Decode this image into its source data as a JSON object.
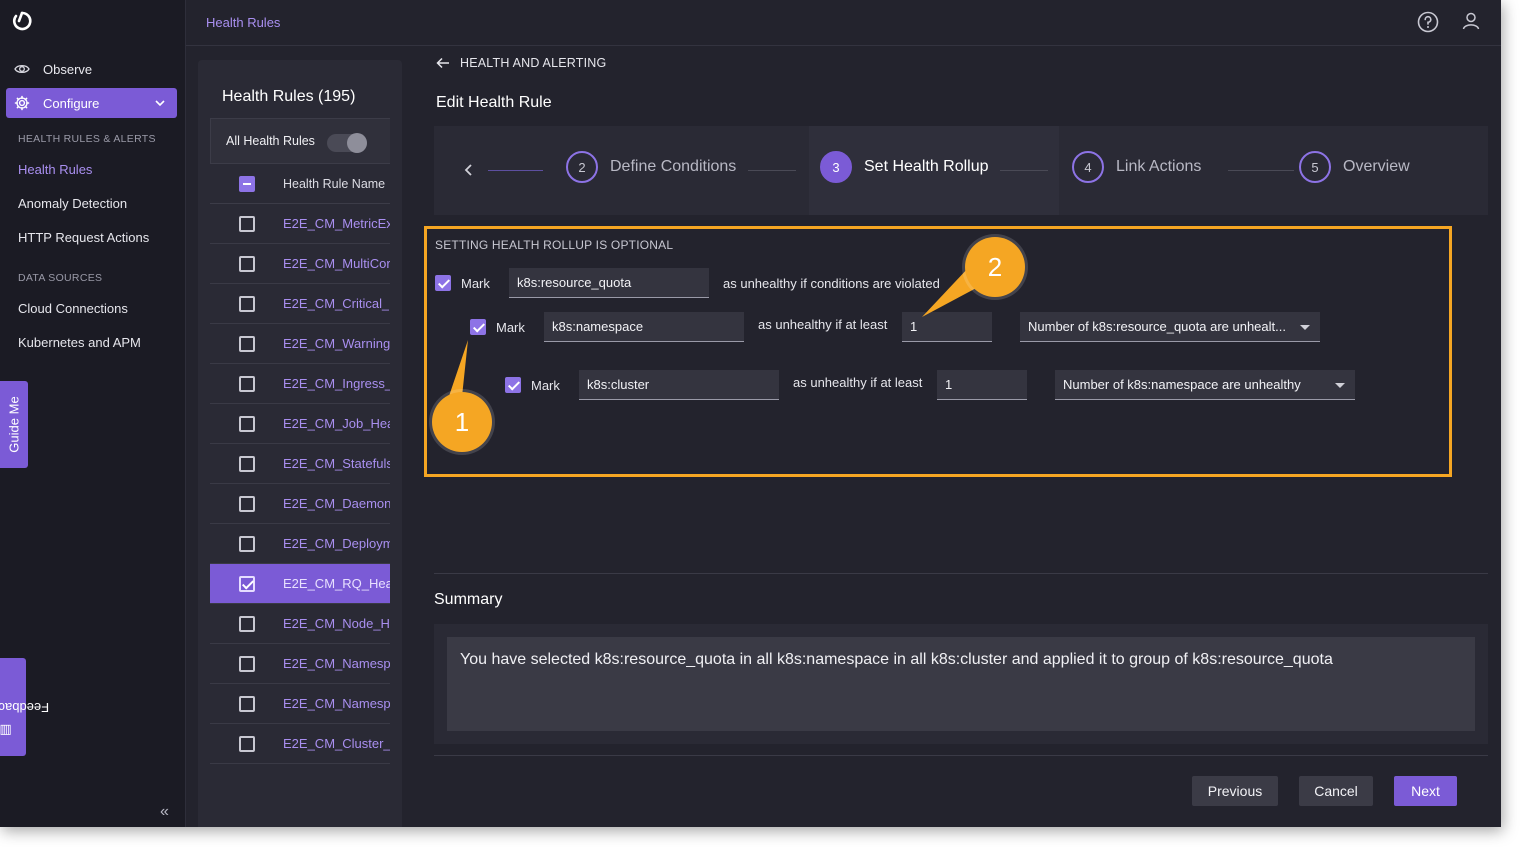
{
  "topbar": {
    "breadcrumb": "Health Rules"
  },
  "sidebar": {
    "observe": "Observe",
    "configure": "Configure",
    "section_health": "HEALTH RULES & ALERTS",
    "health_items": [
      "Health Rules",
      "Anomaly Detection",
      "HTTP Request Actions"
    ],
    "section_data": "DATA SOURCES",
    "data_items": [
      "Cloud Connections",
      "Kubernetes and APM"
    ],
    "guide_me": "Guide Me",
    "feedback": "Feedback"
  },
  "rules_panel": {
    "title": "Health Rules (195)",
    "toggle_label": "All Health Rules",
    "column_header": "Health Rule Name",
    "rows": [
      {
        "name": "E2E_CM_MetricEx",
        "checked": false
      },
      {
        "name": "E2E_CM_MultiCor",
        "checked": false
      },
      {
        "name": "E2E_CM_Critical_",
        "checked": false
      },
      {
        "name": "E2E_CM_Warning",
        "checked": false
      },
      {
        "name": "E2E_CM_Ingress_",
        "checked": false
      },
      {
        "name": "E2E_CM_Job_Hea",
        "checked": false
      },
      {
        "name": "E2E_CM_Statefuls",
        "checked": false
      },
      {
        "name": "E2E_CM_Daemon",
        "checked": false
      },
      {
        "name": "E2E_CM_Deploym",
        "checked": false
      },
      {
        "name": "E2E_CM_RQ_Hea",
        "checked": true
      },
      {
        "name": "E2E_CM_Node_H",
        "checked": false
      },
      {
        "name": "E2E_CM_Namesp",
        "checked": false
      },
      {
        "name": "E2E_CM_Namesp",
        "checked": false
      },
      {
        "name": "E2E_CM_Cluster_",
        "checked": false
      }
    ]
  },
  "main": {
    "back_label": "HEALTH AND ALERTING",
    "page_title": "Edit Health Rule",
    "steps": [
      {
        "num": "2",
        "label": "Define Conditions"
      },
      {
        "num": "3",
        "label": "Set Health Rollup"
      },
      {
        "num": "4",
        "label": "Link Actions"
      },
      {
        "num": "5",
        "label": "Overview"
      }
    ],
    "rollup": {
      "caption": "SETTING HEALTH ROLLUP IS OPTIONAL",
      "mark_label": "Mark",
      "row1": {
        "entity": "k8s:resource_quota",
        "suffix": "as unhealthy if conditions are violated"
      },
      "row2": {
        "entity": "k8s:namespace",
        "suffix": "as unhealthy if at least",
        "count": "1",
        "select": "Number of k8s:resource_quota are unhealt..."
      },
      "row3": {
        "entity": "k8s:cluster",
        "suffix": "as unhealthy if at least",
        "count": "1",
        "select": "Number of k8s:namespace are unhealthy"
      }
    },
    "callouts": [
      "1",
      "2"
    ],
    "summary_title": "Summary",
    "summary_text": "You have selected k8s:resource_quota in all k8s:namespace in all k8s:cluster and applied it to group of k8s:resource_quota",
    "buttons": {
      "previous": "Previous",
      "cancel": "Cancel",
      "next": "Next"
    }
  },
  "colors": {
    "accent": "#7b5bd6",
    "callout": "#f5a623"
  }
}
